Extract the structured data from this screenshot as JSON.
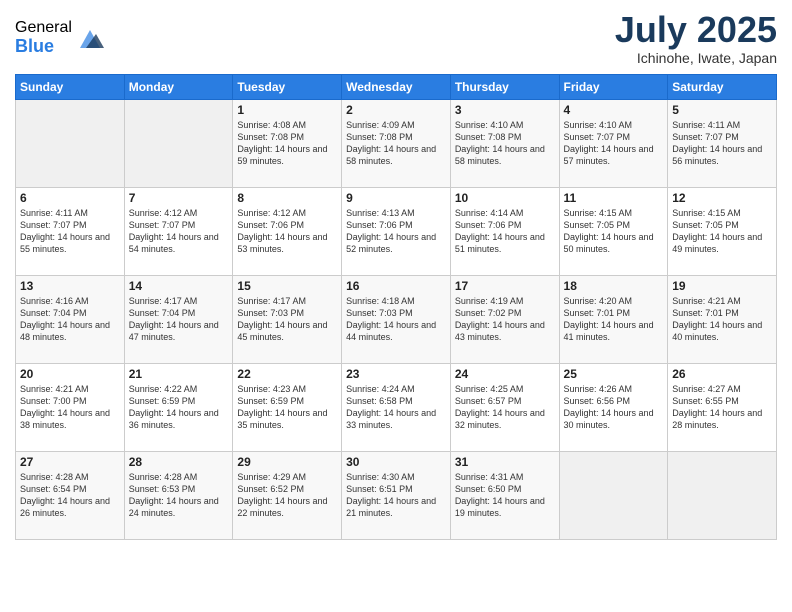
{
  "logo": {
    "general": "General",
    "blue": "Blue"
  },
  "header": {
    "month_year": "July 2025",
    "location": "Ichinohe, Iwate, Japan"
  },
  "weekdays": [
    "Sunday",
    "Monday",
    "Tuesday",
    "Wednesday",
    "Thursday",
    "Friday",
    "Saturday"
  ],
  "weeks": [
    [
      {
        "day": "",
        "empty": true
      },
      {
        "day": "",
        "empty": true
      },
      {
        "day": "1",
        "sunrise": "4:08 AM",
        "sunset": "7:08 PM",
        "daylight": "14 hours and 59 minutes."
      },
      {
        "day": "2",
        "sunrise": "4:09 AM",
        "sunset": "7:08 PM",
        "daylight": "14 hours and 58 minutes."
      },
      {
        "day": "3",
        "sunrise": "4:10 AM",
        "sunset": "7:08 PM",
        "daylight": "14 hours and 58 minutes."
      },
      {
        "day": "4",
        "sunrise": "4:10 AM",
        "sunset": "7:07 PM",
        "daylight": "14 hours and 57 minutes."
      },
      {
        "day": "5",
        "sunrise": "4:11 AM",
        "sunset": "7:07 PM",
        "daylight": "14 hours and 56 minutes."
      }
    ],
    [
      {
        "day": "6",
        "sunrise": "4:11 AM",
        "sunset": "7:07 PM",
        "daylight": "14 hours and 55 minutes."
      },
      {
        "day": "7",
        "sunrise": "4:12 AM",
        "sunset": "7:07 PM",
        "daylight": "14 hours and 54 minutes."
      },
      {
        "day": "8",
        "sunrise": "4:12 AM",
        "sunset": "7:06 PM",
        "daylight": "14 hours and 53 minutes."
      },
      {
        "day": "9",
        "sunrise": "4:13 AM",
        "sunset": "7:06 PM",
        "daylight": "14 hours and 52 minutes."
      },
      {
        "day": "10",
        "sunrise": "4:14 AM",
        "sunset": "7:06 PM",
        "daylight": "14 hours and 51 minutes."
      },
      {
        "day": "11",
        "sunrise": "4:15 AM",
        "sunset": "7:05 PM",
        "daylight": "14 hours and 50 minutes."
      },
      {
        "day": "12",
        "sunrise": "4:15 AM",
        "sunset": "7:05 PM",
        "daylight": "14 hours and 49 minutes."
      }
    ],
    [
      {
        "day": "13",
        "sunrise": "4:16 AM",
        "sunset": "7:04 PM",
        "daylight": "14 hours and 48 minutes."
      },
      {
        "day": "14",
        "sunrise": "4:17 AM",
        "sunset": "7:04 PM",
        "daylight": "14 hours and 47 minutes."
      },
      {
        "day": "15",
        "sunrise": "4:17 AM",
        "sunset": "7:03 PM",
        "daylight": "14 hours and 45 minutes."
      },
      {
        "day": "16",
        "sunrise": "4:18 AM",
        "sunset": "7:03 PM",
        "daylight": "14 hours and 44 minutes."
      },
      {
        "day": "17",
        "sunrise": "4:19 AM",
        "sunset": "7:02 PM",
        "daylight": "14 hours and 43 minutes."
      },
      {
        "day": "18",
        "sunrise": "4:20 AM",
        "sunset": "7:01 PM",
        "daylight": "14 hours and 41 minutes."
      },
      {
        "day": "19",
        "sunrise": "4:21 AM",
        "sunset": "7:01 PM",
        "daylight": "14 hours and 40 minutes."
      }
    ],
    [
      {
        "day": "20",
        "sunrise": "4:21 AM",
        "sunset": "7:00 PM",
        "daylight": "14 hours and 38 minutes."
      },
      {
        "day": "21",
        "sunrise": "4:22 AM",
        "sunset": "6:59 PM",
        "daylight": "14 hours and 36 minutes."
      },
      {
        "day": "22",
        "sunrise": "4:23 AM",
        "sunset": "6:59 PM",
        "daylight": "14 hours and 35 minutes."
      },
      {
        "day": "23",
        "sunrise": "4:24 AM",
        "sunset": "6:58 PM",
        "daylight": "14 hours and 33 minutes."
      },
      {
        "day": "24",
        "sunrise": "4:25 AM",
        "sunset": "6:57 PM",
        "daylight": "14 hours and 32 minutes."
      },
      {
        "day": "25",
        "sunrise": "4:26 AM",
        "sunset": "6:56 PM",
        "daylight": "14 hours and 30 minutes."
      },
      {
        "day": "26",
        "sunrise": "4:27 AM",
        "sunset": "6:55 PM",
        "daylight": "14 hours and 28 minutes."
      }
    ],
    [
      {
        "day": "27",
        "sunrise": "4:28 AM",
        "sunset": "6:54 PM",
        "daylight": "14 hours and 26 minutes."
      },
      {
        "day": "28",
        "sunrise": "4:28 AM",
        "sunset": "6:53 PM",
        "daylight": "14 hours and 24 minutes."
      },
      {
        "day": "29",
        "sunrise": "4:29 AM",
        "sunset": "6:52 PM",
        "daylight": "14 hours and 22 minutes."
      },
      {
        "day": "30",
        "sunrise": "4:30 AM",
        "sunset": "6:51 PM",
        "daylight": "14 hours and 21 minutes."
      },
      {
        "day": "31",
        "sunrise": "4:31 AM",
        "sunset": "6:50 PM",
        "daylight": "14 hours and 19 minutes."
      },
      {
        "day": "",
        "empty": true
      },
      {
        "day": "",
        "empty": true
      }
    ]
  ]
}
